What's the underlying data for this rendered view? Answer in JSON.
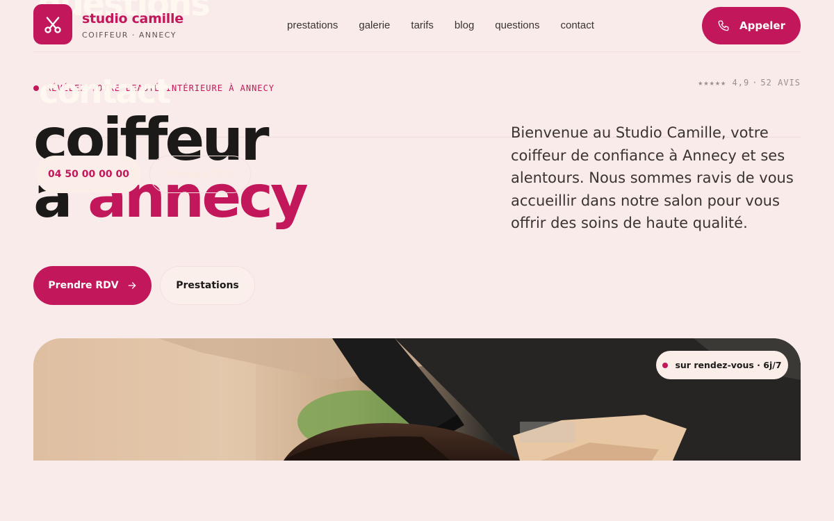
{
  "ghost": {
    "line1": "questions",
    "line2": "contact"
  },
  "brand": {
    "name": "studio camille",
    "subtitle": "COIFFEUR · ANNECY",
    "logo_icon": "scissors-icon"
  },
  "nav": {
    "items": [
      "prestations",
      "galerie",
      "tarifs",
      "blog",
      "questions",
      "contact"
    ]
  },
  "header": {
    "call_label": "Appeler",
    "call_icon": "phone-icon"
  },
  "hero": {
    "eyebrow": "RÉVÉLEZ VOTRE BEAUTÉ INTÉRIEURE À ANNECY",
    "rating_stars": "★★★★★",
    "rating_value": "4,9",
    "rating_reviews": "52 AVIS",
    "title_line1": "coiffeur",
    "title_line2_prefix": "à",
    "title_line2_accent": "annecy",
    "intro": "Bienvenue au Studio Camille, votre coiffeur de confiance à Annecy et ses alentours. Nous sommes ravis de vous accueillir dans notre salon pour vous offrir des soins de haute qualité.",
    "floating_phone": "04 50 00 00 00",
    "floating_rdv": "Prendre RDV",
    "cta_primary": "Prendre RDV",
    "cta_secondary": "Prestations"
  },
  "photo": {
    "badge": "sur rendez-vous · 6j/7"
  },
  "colors": {
    "accent": "#c2185b",
    "background": "#f9ebea",
    "text": "#1c1a19"
  }
}
